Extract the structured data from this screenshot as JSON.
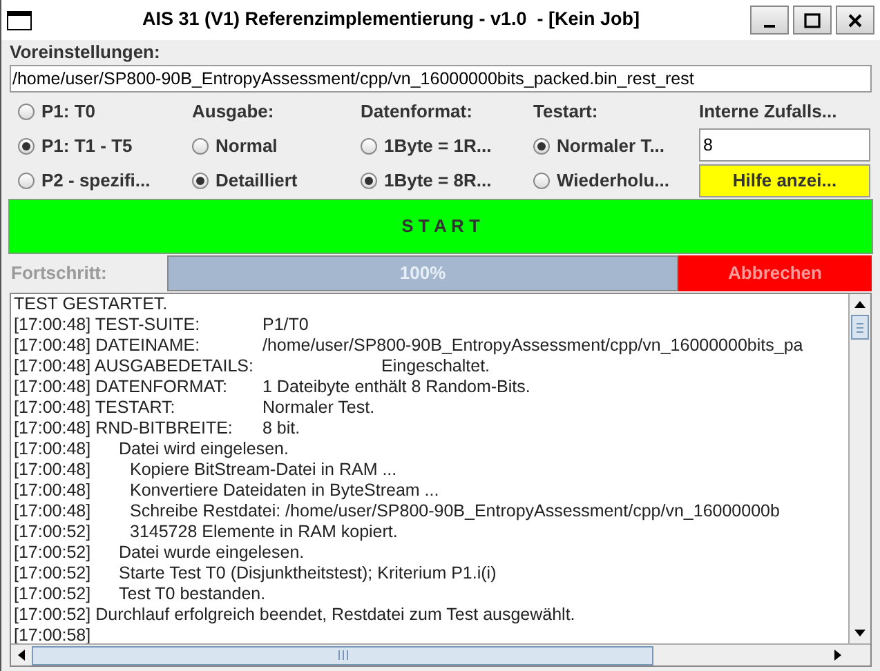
{
  "window": {
    "title": "AIS 31 (V1) Referenzimplementierung - v1.0  - [Kein Job]"
  },
  "presets": {
    "label": "Voreinstellungen:",
    "path": "/home/user/SP800-90B_EntropyAssessment/cpp/vn_16000000bits_packed.bin_rest_rest"
  },
  "option_columns": [
    {
      "options": [
        {
          "label": "P1: T0",
          "selected": false
        },
        {
          "label": "P1: T1 - T5",
          "selected": true
        },
        {
          "label": "P2 - spezifi...",
          "selected": false
        }
      ]
    },
    {
      "heading": "Ausgabe:",
      "options": [
        {
          "label": "Normal",
          "selected": false
        },
        {
          "label": "Detailliert",
          "selected": true
        }
      ]
    },
    {
      "heading": "Datenformat:",
      "options": [
        {
          "label": "1Byte = 1R...",
          "selected": false
        },
        {
          "label": "1Byte = 8R...",
          "selected": true
        }
      ]
    },
    {
      "heading": "Testart:",
      "options": [
        {
          "label": "Normaler T...",
          "selected": true
        },
        {
          "label": "Wiederholu...",
          "selected": false
        }
      ]
    }
  ],
  "random_width": {
    "heading": "Interne Zufalls...",
    "value": "8"
  },
  "help_button": "Hilfe anzei...",
  "start_button": "S T A R T",
  "progress": {
    "label": "Fortschritt:",
    "level": 1,
    "reading": "100%",
    "disabled": true
  },
  "cancel_button": {
    "label": "Abbrechen",
    "disabled": true
  },
  "log": [
    {
      "kind": "header",
      "text": "TEST GESTARTET."
    },
    {
      "kind": "field",
      "time": "[17:00:48]",
      "key": "TEST-SUITE:",
      "value": "P1/T0"
    },
    {
      "kind": "field",
      "time": "[17:00:48]",
      "key": "DATEINAME:",
      "value": "/home/user/SP800-90B_EntropyAssessment/cpp/vn_16000000bits_pa"
    },
    {
      "kind": "wide",
      "time": "[17:00:48]",
      "key": "AUSGABEDETAILS:",
      "value": "Eingeschaltet."
    },
    {
      "kind": "field",
      "time": "[17:00:48]",
      "key": "DATENFORMAT:",
      "value": "1 Dateibyte enthält 8 Random-Bits."
    },
    {
      "kind": "field",
      "time": "[17:00:48]",
      "key": "TESTART:",
      "value": "Normaler Test."
    },
    {
      "kind": "field",
      "time": "[17:00:48]",
      "key": "RND-BITBREITE:",
      "value": "8 bit."
    },
    {
      "kind": "step",
      "time": "[17:00:48]",
      "text": "Datei wird eingelesen."
    },
    {
      "kind": "substep",
      "time": "[17:00:48]",
      "text": "Kopiere BitStream-Datei in RAM ..."
    },
    {
      "kind": "substep",
      "time": "[17:00:48]",
      "text": "Konvertiere Dateidaten in ByteStream ..."
    },
    {
      "kind": "substep",
      "time": "[17:00:48]",
      "text": "Schreibe Restdatei: /home/user/SP800-90B_EntropyAssessment/cpp/vn_16000000b"
    },
    {
      "kind": "substep",
      "time": "[17:00:52]",
      "text": "3145728 Elemente in RAM kopiert."
    },
    {
      "kind": "step",
      "time": "[17:00:52]",
      "text": "Datei wurde eingelesen."
    },
    {
      "kind": "step",
      "time": "[17:00:52]",
      "text": "Starte Test T0 (Disjunktheitstest); Kriterium P1.i(i)"
    },
    {
      "kind": "step",
      "time": "[17:00:52]",
      "text": "Test T0 bestanden."
    },
    {
      "kind": "plain",
      "time": "[17:00:52]",
      "text": "Durchlauf erfolgreich beendet, Restdatei zum Test ausgewählt."
    },
    {
      "kind": "plain",
      "time": "[17:00:58]"
    }
  ]
}
